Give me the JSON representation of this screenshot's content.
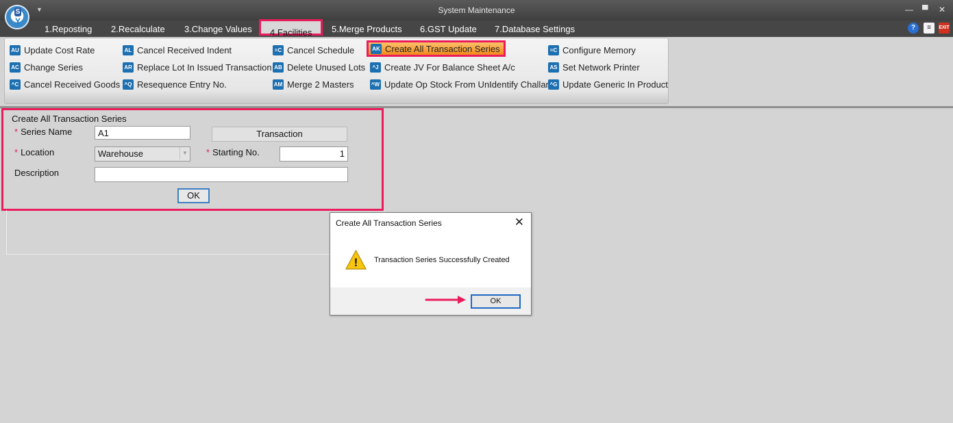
{
  "window": {
    "title": "System Maintenance",
    "controls": [
      "minimize",
      "maximize",
      "close"
    ]
  },
  "logo": {
    "letter": "S"
  },
  "tabs": [
    {
      "label": "1.Reposting"
    },
    {
      "label": "2.Recalculate"
    },
    {
      "label": "3.Change Values"
    },
    {
      "label": "4.Facilities",
      "active": true
    },
    {
      "label": "5.Merge Products"
    },
    {
      "label": "6.GST Update"
    },
    {
      "label": "7.Database Settings"
    }
  ],
  "ribbon": {
    "items": [
      {
        "label": "Update Cost Rate",
        "icon": "AU"
      },
      {
        "label": "Change Series",
        "icon": "AC"
      },
      {
        "label": "Cancel Received Goods",
        "icon": "^C"
      },
      {
        "label": "Cancel Received Indent",
        "icon": "AL"
      },
      {
        "label": "Replace Lot In Issued Transaction",
        "icon": "AR"
      },
      {
        "label": "Resequence Entry No.",
        "icon": "^Q"
      },
      {
        "label": "Cancel Schedule",
        "icon": "=C"
      },
      {
        "label": "Delete Unused Lots",
        "icon": "AB"
      },
      {
        "label": "Merge 2 Masters",
        "icon": "AM"
      },
      {
        "label": "Create All Transaction Series",
        "icon": "AK",
        "selected": true
      },
      {
        "label": "Create JV For Balance Sheet A/c",
        "icon": "^J"
      },
      {
        "label": "Update Op Stock From UnIdentify Challan",
        "icon": "^W"
      },
      {
        "label": "Configure Memory",
        "icon": "=C"
      },
      {
        "label": "Set Network Printer",
        "icon": "AS"
      },
      {
        "label": "Update Generic In Product",
        "icon": "^G"
      }
    ]
  },
  "form": {
    "title": "Create All Transaction Series",
    "series_name_label": "Series Name",
    "series_name_value": "A1",
    "location_label": "Location",
    "location_value": "Warehouse",
    "starting_no_label": "Starting No.",
    "starting_no_value": "1",
    "description_label": "Description",
    "description_value": "",
    "transaction_button": "Transaction",
    "ok_button": "OK",
    "required_mark": "*"
  },
  "dialog": {
    "title": "Create All Transaction Series",
    "message": "Transaction Series Successfully Created",
    "ok_button": "OK",
    "close_glyph": "✕",
    "warning_glyph": "!"
  },
  "colors": {
    "highlight": "#ea1c5c",
    "selected_item": "#f48a1b",
    "icon_blue": "#1c6fb0",
    "titlebar": "#464646"
  }
}
